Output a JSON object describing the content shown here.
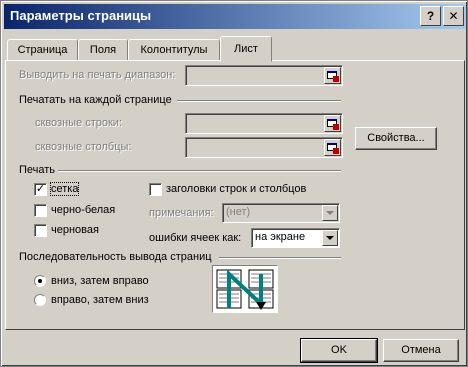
{
  "title": "Параметры страницы",
  "title_buttons": {
    "help": "?",
    "close": "✕"
  },
  "tabs": [
    "Страница",
    "Поля",
    "Колонтитулы",
    "Лист"
  ],
  "print_area": {
    "label": "Выводить на печать диапазон:",
    "value": ""
  },
  "print_titles": {
    "heading": "Печатать на каждой странице",
    "rows_label": "сквозные строки:",
    "rows_value": "",
    "cols_label": "сквозные столбцы:",
    "cols_value": ""
  },
  "properties_button": "Свойства...",
  "print": {
    "heading": "Печать",
    "gridlines": {
      "label": "сетка",
      "checked": true
    },
    "black_white": {
      "label": "черно-белая",
      "checked": false
    },
    "draft": {
      "label": "черновая",
      "checked": false
    },
    "headings": {
      "label": "заголовки строк и столбцов",
      "checked": false
    },
    "comments_label": "примечания:",
    "comments_value": "(нет)",
    "errors_label": "ошибки ячеек как:",
    "errors_value": "на экране"
  },
  "page_order": {
    "heading": "Последовательность вывода страниц",
    "down_then_over": {
      "label": "вниз, затем вправо",
      "selected": true
    },
    "over_then_down": {
      "label": "вправо, затем вниз",
      "selected": false
    }
  },
  "footer": {
    "ok": "OK",
    "cancel": "Отмена"
  },
  "colors": {
    "titlebar_start": "#0a246a",
    "titlebar_end": "#a6caf0",
    "face": "#d4d0c8",
    "order_arrow": "#008080"
  }
}
